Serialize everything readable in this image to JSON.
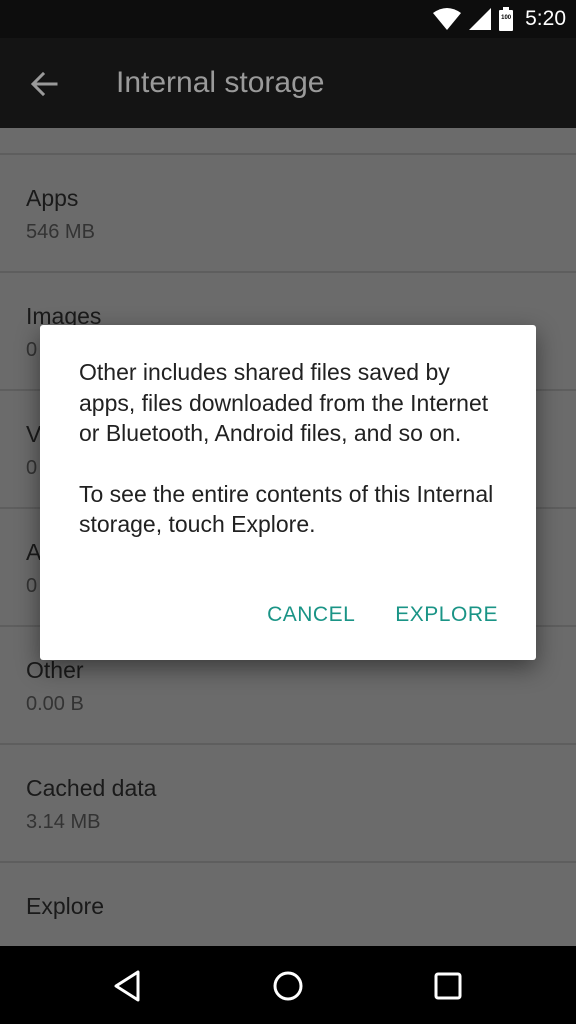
{
  "status_bar": {
    "time": "5:20",
    "battery_level": "100"
  },
  "toolbar": {
    "title": "Internal storage",
    "back_icon": "arrow-back-icon"
  },
  "list": {
    "items": [
      {
        "label": "Apps",
        "value": "546 MB"
      },
      {
        "label": "Images",
        "value": "0"
      },
      {
        "label": "V",
        "value": "0"
      },
      {
        "label": "A",
        "value": "0"
      },
      {
        "label": "Other",
        "value": "0.00 B"
      },
      {
        "label": "Cached data",
        "value": "3.14 MB"
      },
      {
        "label": "Explore",
        "value": ""
      }
    ]
  },
  "dialog": {
    "message_1": "Other includes shared files saved by apps, files downloaded from the Internet or Bluetooth, Android files, and so on.",
    "message_2": "To see the entire contents of this Internal storage, touch Explore.",
    "cancel_label": "CANCEL",
    "explore_label": "EXPLORE",
    "accent_color": "#1a9486"
  },
  "nav_bar": {
    "back_icon": "nav-back-icon",
    "home_icon": "nav-home-icon",
    "recents_icon": "nav-recents-icon"
  }
}
